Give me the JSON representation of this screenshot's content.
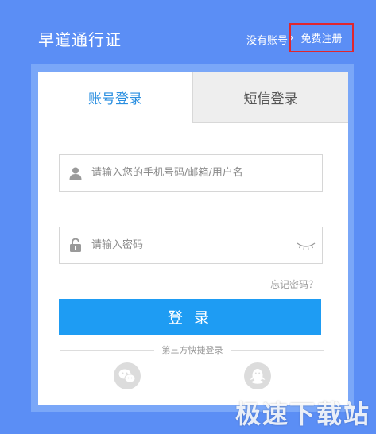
{
  "header": {
    "title": "早道通行证",
    "no_account_text": "没有账号？",
    "register_label": "免费注册"
  },
  "tabs": [
    {
      "label": "账号登录",
      "active": true
    },
    {
      "label": "短信登录",
      "active": false
    }
  ],
  "form": {
    "username_placeholder": "请输入您的手机号码/邮箱/用户名",
    "password_placeholder": "请输入密码",
    "forgot_label": "忘记密码？",
    "login_label": "登 录"
  },
  "social": {
    "divider_text": "第三方快捷登录",
    "buttons": [
      {
        "icon": "wechat-icon"
      },
      {
        "icon": "qq-icon"
      }
    ]
  },
  "watermark": "极速下载站",
  "colors": {
    "background": "#5b8ef5",
    "frame": "#7aa7f8",
    "accent": "#1e9cf3",
    "active_tab_text": "#2b8fe0",
    "highlight_border": "#e0262e"
  }
}
